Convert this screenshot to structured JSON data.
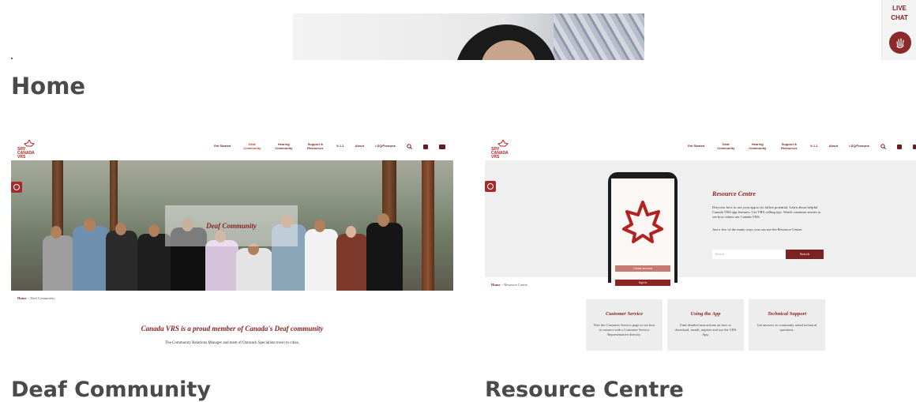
{
  "page": {
    "title": "Home"
  },
  "live_chat": {
    "label_line1": "LIVE",
    "label_line2": "CHAT",
    "icon": "hand-wave-icon"
  },
  "left_card": {
    "logo_lines": [
      "SRV",
      "CANADA",
      "VRS"
    ],
    "nav": [
      "Get Started",
      "Deaf Community",
      "Hearing Community",
      "Support & Resources",
      "9-1-1",
      "About",
      "LSQ/Français"
    ],
    "hero_label": "Deaf Community",
    "breadcrumb_home": "Home",
    "breadcrumb_current": "Deaf Community",
    "headline": "Canada VRS is a proud member of Canada's Deaf community",
    "body": "The Community Relations Manager and team of Outreach Specialists travel to cities,",
    "caption": "Deaf Community"
  },
  "right_card": {
    "logo_lines": [
      "SRV",
      "CANADA",
      "VRS"
    ],
    "nav": [
      "Get Started",
      "Deaf Community",
      "Hearing Community",
      "Support & Resources",
      "9-1-1",
      "About",
      "LSQ/Français"
    ],
    "title": "Resource Centre",
    "para1": "Discover how to use your app to its fullest potential. Learn about helpful Canada VRS app features. Get VRS calling tips. Watch customer stories to see how others use Canada VRS.",
    "para2": "Just a few of the many ways you can use the Resource Centre.",
    "search_placeholder": "Search...",
    "search_button": "Search",
    "phone_btn1": "Create account",
    "phone_btn2": "Sign in",
    "breadcrumb_home": "Home",
    "breadcrumb_current": "Resource Centre",
    "cards": [
      {
        "title": "Customer Service",
        "desc": "Visit the Customer Service page to see how to connect with a Customer Service Representative directly."
      },
      {
        "title": "Using the App",
        "desc": "Find detailed instructions on how to download, install, register and use the VRS App."
      },
      {
        "title": "Technical Support",
        "desc": "Get answers to commonly asked technical questions."
      }
    ],
    "caption": "Resource Centre"
  },
  "colors": {
    "brand_red": "#8a2020",
    "accent": "#c0392b",
    "title_grey": "#4a4a4a"
  }
}
